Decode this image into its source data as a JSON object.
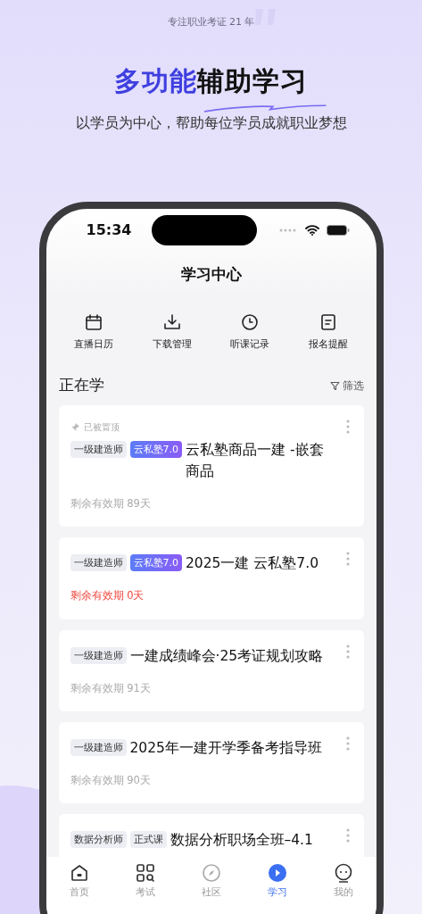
{
  "promo": {
    "tagline": "专注职业考证 21 年",
    "headline_highlight": "多功能",
    "headline_rest": "辅助学习",
    "subtitle": "以学员为中心，帮助每位学员成就职业梦想"
  },
  "status_bar": {
    "time": "15:34"
  },
  "page_title": "学习中心",
  "quick_actions": [
    {
      "kind": "calendar",
      "label": "直播日历"
    },
    {
      "kind": "download",
      "label": "下载管理"
    },
    {
      "kind": "clock",
      "label": "听课记录"
    },
    {
      "kind": "note",
      "label": "报名提醒"
    }
  ],
  "section": {
    "title": "正在学",
    "filter": "筛选"
  },
  "courses": [
    {
      "pinned": true,
      "pinned_label": "已被置顶",
      "tags": [
        {
          "text": "一级建造师",
          "kind": "category"
        },
        {
          "text": "云私塾7.0",
          "kind": "product"
        }
      ],
      "title": "云私塾商品一建 -嵌套商品",
      "expiry": "剩余有效期 89天",
      "expired": false
    },
    {
      "pinned": false,
      "tags": [
        {
          "text": "一级建造师",
          "kind": "category"
        },
        {
          "text": "云私塾7.0",
          "kind": "product"
        }
      ],
      "title": "2025一建  云私塾7.0",
      "expiry": "剩余有效期 0天",
      "expired": true
    },
    {
      "pinned": false,
      "tags": [
        {
          "text": "一级建造师",
          "kind": "category"
        }
      ],
      "title": "一建成绩峰会·25考证规划攻略",
      "expiry": "剩余有效期 91天",
      "expired": false
    },
    {
      "pinned": false,
      "tags": [
        {
          "text": "一级建造师",
          "kind": "category"
        }
      ],
      "title": "2025年一建开学季备考指导班",
      "expiry": "剩余有效期 90天",
      "expired": false
    },
    {
      "pinned": false,
      "tags": [
        {
          "text": "数据分析师",
          "kind": "category"
        },
        {
          "text": "正式课",
          "kind": "category"
        }
      ],
      "title": "数据分析职场全班–4.1"
    }
  ],
  "tab_bar": [
    {
      "kind": "home",
      "label": "首页",
      "selected": false
    },
    {
      "kind": "exam",
      "label": "考试",
      "selected": false
    },
    {
      "kind": "community",
      "label": "社区",
      "selected": false
    },
    {
      "kind": "study",
      "label": "学习",
      "selected": true
    },
    {
      "kind": "me",
      "label": "我的",
      "selected": false
    }
  ]
}
